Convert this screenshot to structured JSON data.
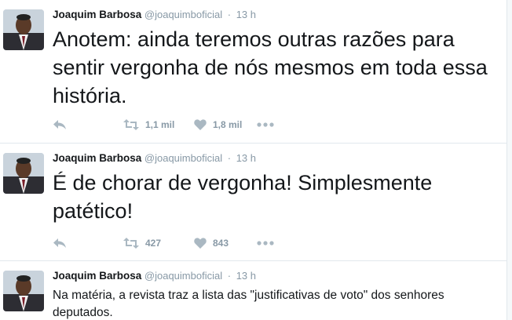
{
  "tweets": [
    {
      "name": "Joaquim Barbosa",
      "handle": "@joaquimboficial",
      "separator": "·",
      "time": "13 h",
      "text": "Anotem: ainda teremos outras razões para sentir vergonha de nós mesmos em toda essa história.",
      "retweets": "1,1 mil",
      "likes": "1,8 mil"
    },
    {
      "name": "Joaquim Barbosa",
      "handle": "@joaquimboficial",
      "separator": "·",
      "time": "13 h",
      "text": "É de chorar de vergonha! Simplesmente patético!",
      "retweets": "427",
      "likes": "843"
    },
    {
      "name": "Joaquim Barbosa",
      "handle": "@joaquimboficial",
      "separator": "·",
      "time": "13 h",
      "text": "Na matéria, a revista traz a lista das \"justificativas de voto\" dos senhores deputados."
    }
  ],
  "colors": {
    "name": "#14171a",
    "meta": "#8899a6",
    "icon": "#aab8c2",
    "divider": "#e1e8ed"
  },
  "icons": [
    "reply-icon",
    "retweet-icon",
    "heart-icon",
    "more-icon"
  ]
}
